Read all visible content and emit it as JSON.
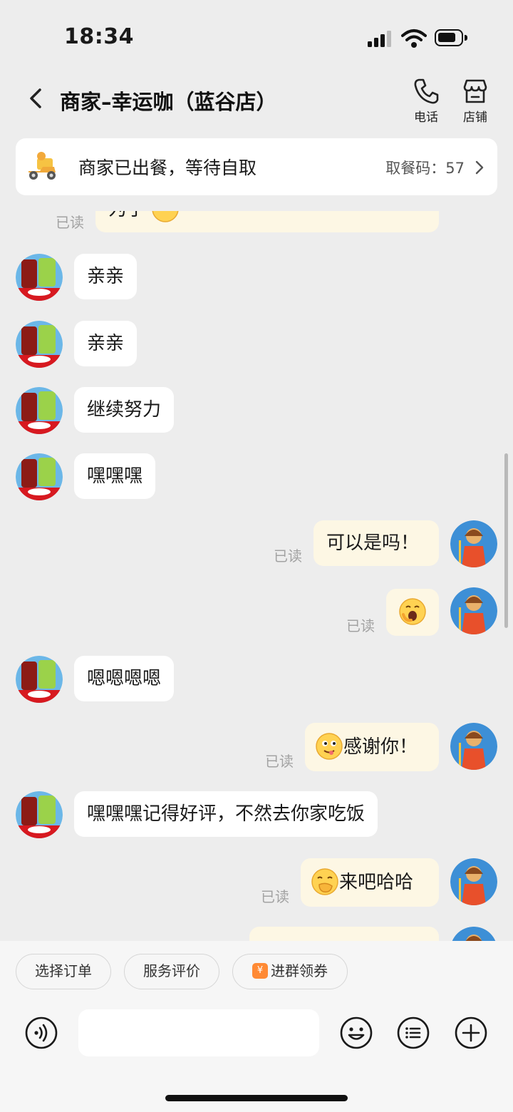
{
  "status_bar": {
    "time": "18:34"
  },
  "header": {
    "title": "商家–幸运咖（蓝谷店）",
    "phone_label": "电话",
    "store_label": "店铺"
  },
  "order": {
    "status": "商家已出餐，等待自取",
    "pickup_label": "取餐码：57"
  },
  "read_label": "已读",
  "messages": [
    {
      "side": "out",
      "text": "为了",
      "partial": true
    },
    {
      "side": "in",
      "text": "亲亲"
    },
    {
      "side": "in",
      "text": "亲亲"
    },
    {
      "side": "in",
      "text": "继续努力"
    },
    {
      "side": "in",
      "text": "嘿嘿嘿"
    },
    {
      "side": "out",
      "text": "可以是吗！"
    },
    {
      "side": "out",
      "text": "",
      "emoji": "yawning-face-emoji"
    },
    {
      "side": "in",
      "text": "嗯嗯嗯嗯"
    },
    {
      "side": "out",
      "text": "感谢你！",
      "emoji": "drooling-face-emoji"
    },
    {
      "side": "in",
      "text": "嘿嘿嘿记得好评，不然去你家吃饭"
    },
    {
      "side": "out",
      "text": "来吧哈哈",
      "emoji": "hand-over-mouth-emoji"
    }
  ],
  "quick_actions": {
    "select_order": "选择订单",
    "service_rating": "服务评价",
    "join_group": "进群领券"
  },
  "input": {
    "placeholder": ""
  },
  "colors": {
    "background": "#ededed",
    "incoming_bubble": "#ffffff",
    "outgoing_bubble": "#fdf7e4",
    "read_text": "#a2a2a2"
  }
}
